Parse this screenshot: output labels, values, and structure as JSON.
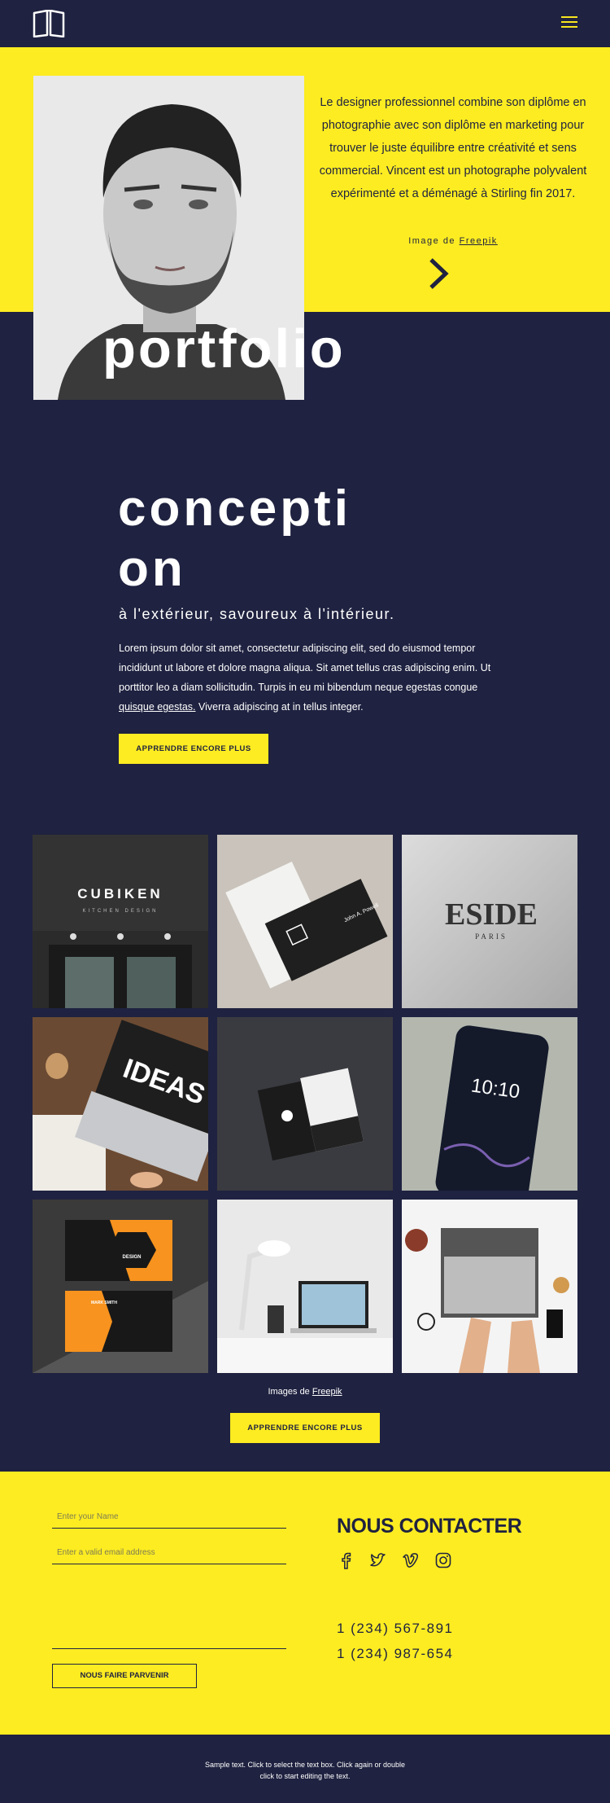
{
  "header": {
    "logo_icon": "book-open-icon",
    "menu_icon": "hamburger-menu-icon"
  },
  "hero": {
    "text": "Le designer professionnel combine son diplôme en photographie avec son diplôme en marketing pour trouver le juste équilibre entre créativité et sens commercial. Vincent est un photographe polyvalent expérimenté et a déménagé à Stirling fin 2017.",
    "credit_prefix": "Image de",
    "credit_link": "Freepik",
    "big_word": "portfolio",
    "arrow_icon": "chevron-right-icon"
  },
  "concept": {
    "title": "concepti on",
    "subtitle": "à l'extérieur, savoureux à l'intérieur.",
    "body_1": "Lorem ipsum dolor sit amet, consectetur adipiscing elit, sed do eiusmod tempor incididunt ut labore et dolore magna aliqua. Sit amet tellus cras adipiscing enim. Ut porttitor leo a diam sollicitudin. Turpis in eu mi bibendum neque egestas congue",
    "body_link": "quisque egestas.",
    "body_2": " Viverra adipiscing at in tellus integer.",
    "button": "APPRENDRE ENCORE PLUS"
  },
  "gallery": {
    "tiles": [
      {
        "sign_title": "CUBIKEN",
        "sign_sub": "KITCHEN DESIGN"
      },
      {
        "card_name": "John A. Powell"
      },
      {
        "logo_title": "ESIDE",
        "logo_sub": "PARIS"
      },
      {
        "word": "IDEAS"
      },
      {
        "card_name": ""
      },
      {
        "time": "10:10"
      },
      {
        "card_title": "DESIGN",
        "card_name": "MARK SMITH"
      },
      {},
      {}
    ],
    "credit_prefix": "Images de",
    "credit_link": "Freepik",
    "button": "APPRENDRE ENCORE PLUS"
  },
  "contact": {
    "name_placeholder": "Enter your Name",
    "email_placeholder": "Enter a valid email address",
    "send_button": "NOUS FAIRE PARVENIR",
    "title": "NOUS CONTACTER",
    "socials": [
      "facebook-icon",
      "twitter-icon",
      "vimeo-icon",
      "instagram-icon"
    ],
    "phone_1": "1 (234) 567-891",
    "phone_2": "1 (234) 987-654"
  },
  "footer": {
    "line_1": "Sample text. Click to select the text box. Click again or double",
    "line_2": "click to start editing the text."
  },
  "colors": {
    "navy": "#1f2240",
    "yellow": "#fdec21",
    "orange": "#f7931e"
  }
}
